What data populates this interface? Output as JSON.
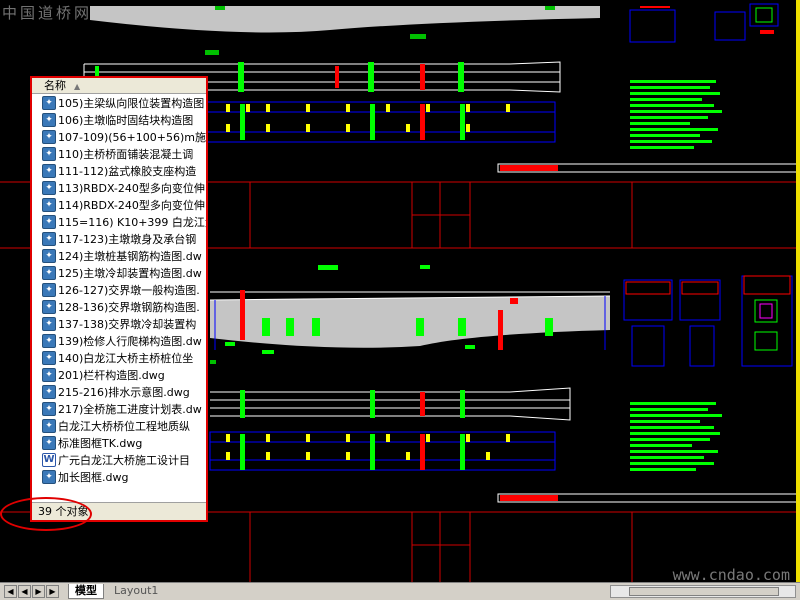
{
  "watermarks": {
    "top_left": "中国道桥网",
    "bottom_right": "www.cndao.com"
  },
  "file_panel": {
    "column_header": "名称",
    "files": [
      {
        "name": "105)主梁纵向限位装置构造图",
        "icon": "dwg-file-icon"
      },
      {
        "name": "106)主墩临时固结块构造图",
        "icon": "dwg-file-icon"
      },
      {
        "name": "107-109)(56+100+56)m施工",
        "icon": "dwg-file-icon"
      },
      {
        "name": "110)主桥桥面铺装混凝土调",
        "icon": "dwg-file-icon"
      },
      {
        "name": "111-112)盆式橡胶支座构造",
        "icon": "dwg-file-icon"
      },
      {
        "name": "113)RBDX-240型多向变位伸",
        "icon": "dwg-file-icon"
      },
      {
        "name": "114)RBDX-240型多向变位伸",
        "icon": "dwg-file-icon"
      },
      {
        "name": "115=116) K10+399 白龙江大",
        "icon": "dwg-file-icon"
      },
      {
        "name": "117-123)主墩墩身及承台钢",
        "icon": "dwg-file-icon"
      },
      {
        "name": "124)主墩桩基钢筋构造图.dw",
        "icon": "dwg-file-icon"
      },
      {
        "name": "125)主墩冷却装置构造图.dw",
        "icon": "dwg-file-icon"
      },
      {
        "name": "126-127)交界墩一般构造图.",
        "icon": "dwg-file-icon"
      },
      {
        "name": "128-136)交界墩钢筋构造图.",
        "icon": "dwg-file-icon"
      },
      {
        "name": "137-138)交界墩冷却装置构",
        "icon": "dwg-file-icon"
      },
      {
        "name": "139)检修人行爬梯构造图.dw",
        "icon": "dwg-file-icon"
      },
      {
        "name": "140)白龙江大桥主桥桩位坐",
        "icon": "dwg-file-icon"
      },
      {
        "name": "201)栏杆构造图.dwg",
        "icon": "dwg-file-icon"
      },
      {
        "name": "215-216)排水示意图.dwg",
        "icon": "dwg-file-icon"
      },
      {
        "name": "217)全桥施工进度计划表.dw",
        "icon": "dwg-file-icon"
      },
      {
        "name": "白龙江大桥桥位工程地质纵",
        "icon": "dwg-file-icon"
      },
      {
        "name": "标准图框TK.dwg",
        "icon": "dwg-file-icon"
      },
      {
        "name": "广元白龙江大桥施工设计目",
        "icon": "word-doc-icon"
      },
      {
        "name": "加长图框.dwg",
        "icon": "dwg-file-icon"
      }
    ],
    "status_text": "39 个对象"
  },
  "tab_bar": {
    "tabs": [
      {
        "label": "模型",
        "active": true
      },
      {
        "label": "Layout1",
        "active": false
      }
    ]
  },
  "colors": {
    "background": "#000000",
    "highlight_red": "#e00000",
    "cad_green": "#00ff00",
    "cad_yellow": "#ffff00",
    "cad_blue": "#0000ff",
    "cad_red": "#ff0000"
  }
}
